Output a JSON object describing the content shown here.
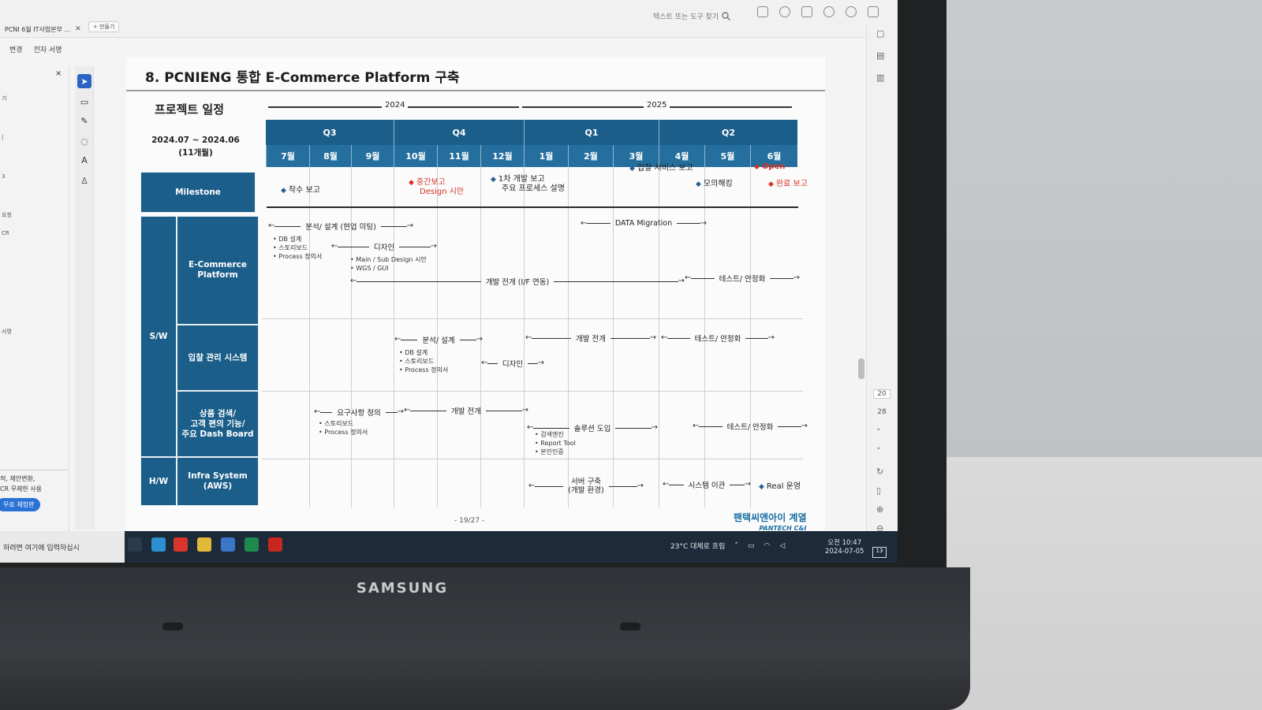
{
  "browser": {
    "tab_title": "PCNI 6월 IT사업본부 ...",
    "tab_close": "✕",
    "new_tab_label": "+ 만들기",
    "search_placeholder": "텍스트 또는 도구 찾기"
  },
  "menu": {
    "items": [
      "변경",
      "전자 서명"
    ]
  },
  "left_panel": {
    "close": "×",
    "items": [
      "기",
      "|",
      "3",
      "요청",
      "CR",
      "서명"
    ],
    "note_line1": "적, 제안변환,",
    "note_line2": "CR 무제한 사용",
    "button": "무료 체험판"
  },
  "right_panel": {
    "page_current": "20",
    "page_total": "28"
  },
  "document": {
    "title": "8. PCNIENG 통합 E-Commerce Platform 구축",
    "section": "프로젝트 일정",
    "period_line1": "2024.07 ~ 2024.06",
    "period_line2": "(11개월)",
    "year_2024": "2024",
    "year_2025": "2025",
    "quarters": [
      "Q3",
      "Q4",
      "Q1",
      "Q2"
    ],
    "months": [
      "7월",
      "8월",
      "9월",
      "10월",
      "11월",
      "12월",
      "1월",
      "2월",
      "3월",
      "4월",
      "5월",
      "6월"
    ],
    "rows": {
      "milestone": "Milestone",
      "sw": "S/W",
      "hw": "H/W",
      "ecommerce_line1": "E-Commerce",
      "ecommerce_line2": "Platform",
      "bidding": "입찰 관리 시스템",
      "product_line1": "상품 검색/",
      "product_line2": "고객 편의 기능/",
      "product_line3": "주요 Dash Board",
      "infra_line1": "Infra System",
      "infra_line2": "(AWS)"
    },
    "milestones": {
      "kickoff": "착수 보고",
      "interim_line1": "중간보고",
      "interim_line2": "Design 시안",
      "dev1_line1": "1차 개발 보고",
      "dev1_line2": "주요 프로세스 설명",
      "bid_service": "입찰 서비스 보고",
      "mock": "모의해킹",
      "open": "Open",
      "final": "완료 보고"
    },
    "activities": {
      "analysis_meeting": "분석/ 설계 (현업 미팅)",
      "data_migration": "DATA Migration",
      "design": "디자인",
      "dev_if": "개발 전개 (I/F 연동)",
      "test_stabilize": "테스트/ 안정화",
      "analysis": "분석/ 설계",
      "dev": "개발 전개",
      "test_stabilize2": "테스트/ 안정화",
      "design2": "디자인",
      "requirements": "요구사항 정의",
      "dev3": "개발 전개",
      "solution": "솔루션 도입",
      "test_stabilize3": "테스트/ 안정화",
      "server_line1": "서버 구축",
      "server_line2": "(개발 환경)",
      "migration": "시스템 이관",
      "real_ops": "Real 운영"
    },
    "notes": {
      "ec_1": "• DB 설계",
      "ec_2": "• 스토리보드",
      "ec_3": "• Process 정의서",
      "ec_4": "• Main / Sub Design 시안",
      "ec_5": "• WGS / GUI",
      "bid_1": "• DB 설계",
      "bid_2": "• 스토리보드",
      "bid_3": "• Process 정의서",
      "prod_1": "• 스토리보드",
      "prod_2": "• Process 정의서",
      "sol_1": "• 검색엔진",
      "sol_2": "• Report Tool",
      "sol_3": "• 본인인증"
    },
    "page_number": "- 19/27 -",
    "logo_line1": "팬택씨앤아이 계열",
    "logo_line2": "PANTECH C&I"
  },
  "taskbar": {
    "search": "하려면 여기에 입력하십시",
    "weather": "23°C 대체로 흐림",
    "time": "오전 10:47",
    "date": "2024-07-05",
    "notifications": "13"
  }
}
